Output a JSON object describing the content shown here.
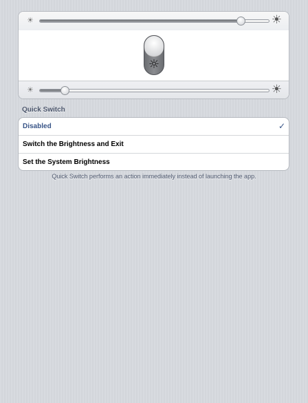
{
  "brightness_panel": {
    "top_slider": {
      "value_fraction": 0.88,
      "min_icon": "sun-small-icon",
      "max_icon": "sun-large-icon"
    },
    "toggle": {
      "icon": "sun-icon",
      "state": "on"
    },
    "bottom_slider": {
      "value_fraction": 0.11,
      "min_icon": "sun-small-icon",
      "max_icon": "sun-large-icon"
    }
  },
  "quick_switch": {
    "header": "Quick Switch",
    "options": [
      {
        "label": "Disabled",
        "selected": true
      },
      {
        "label": "Switch the Brightness and Exit",
        "selected": false
      },
      {
        "label": "Set the System Brightness",
        "selected": false
      }
    ],
    "checkmark": "✓",
    "footer": "Quick Switch performs an action immediately instead of launching the app."
  },
  "colors": {
    "selected_text": "#385487",
    "section_text": "#4c566c",
    "background": "#d6d9de"
  }
}
